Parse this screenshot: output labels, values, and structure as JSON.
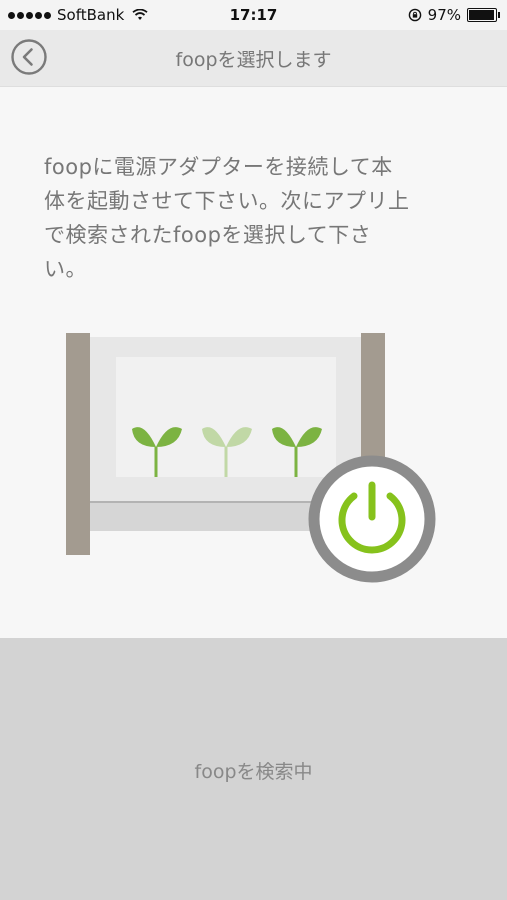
{
  "status_bar": {
    "carrier": "SoftBank",
    "time": "17:17",
    "battery": "97%"
  },
  "nav": {
    "title": "foopを選択します",
    "back_icon": "chevron-left-circle-icon"
  },
  "instruction": {
    "lines": [
      "foopに電源アダプターを接続して本",
      "体を起動させて下さい。次にアプリ上",
      "で検索されたfoopを選択して下さ",
      "い。"
    ]
  },
  "status": {
    "text": "foopを検索中"
  },
  "colors": {
    "power_ring": "#8c8c8c",
    "power_green": "#86c21c",
    "plant_green": "#7cb342",
    "frame_post": "#a39b90"
  }
}
